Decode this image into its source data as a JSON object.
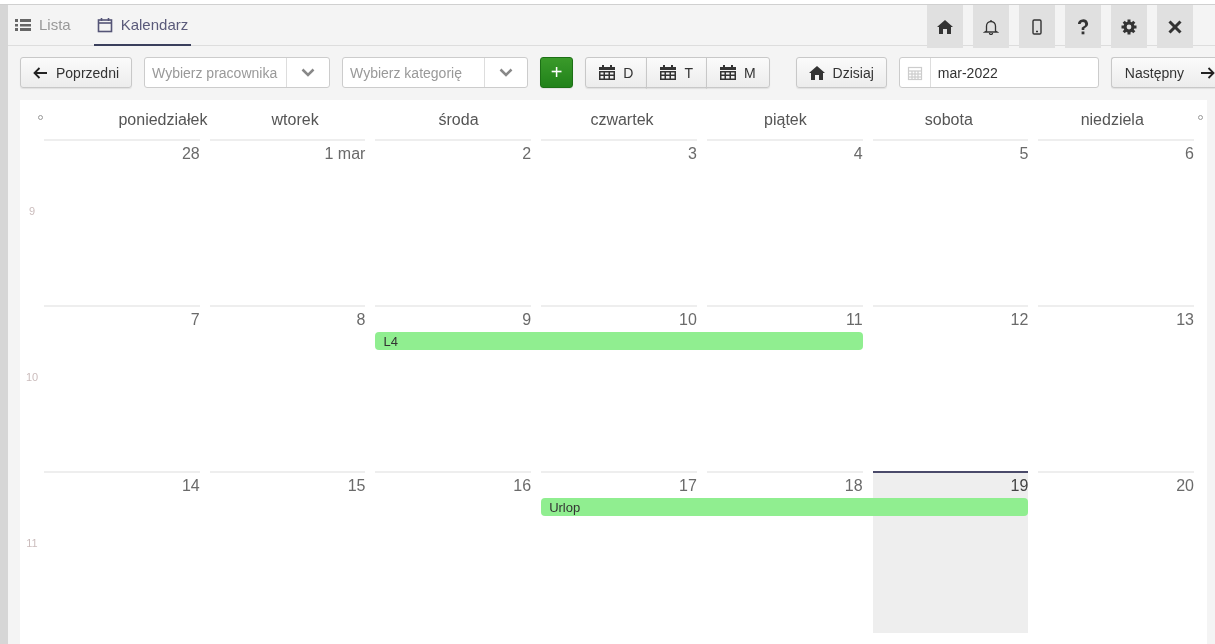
{
  "tabs": [
    {
      "label": "Lista",
      "selected": false
    },
    {
      "label": "Kalendarz",
      "selected": true
    }
  ],
  "toolbar": {
    "previous": {
      "label": "Poprzedni"
    },
    "selects": [
      {
        "placeholder": "Wybierz pracownika"
      },
      {
        "placeholder": "Wybierz kategorię"
      }
    ],
    "add_button": {
      "label": "+"
    },
    "views": [
      {
        "label": "D",
        "selected": false
      },
      {
        "label": "T",
        "selected": false
      },
      {
        "label": "M",
        "selected": false
      }
    ],
    "today_button": {
      "label": "Dzisiaj"
    },
    "date_field": {
      "value": "mar-2022"
    },
    "next": {
      "label": "Następny"
    }
  },
  "calendar": {
    "weekdays": [
      "poniedziałek",
      "wtorek",
      "środa",
      "czwartek",
      "piątek",
      "sobota",
      "niedziela"
    ],
    "weeks": [
      {
        "week_number": "9",
        "days": [
          {
            "label": "28",
            "today": false
          },
          {
            "label": "1 mar",
            "today": false
          },
          {
            "label": "2",
            "today": false
          },
          {
            "label": "3",
            "today": false
          },
          {
            "label": "4",
            "today": false
          },
          {
            "label": "5",
            "today": false
          },
          {
            "label": "6",
            "today": false
          }
        ]
      },
      {
        "week_number": "10",
        "days": [
          {
            "label": "7",
            "today": false
          },
          {
            "label": "8",
            "today": false
          },
          {
            "label": "9",
            "today": false
          },
          {
            "label": "10",
            "today": false
          },
          {
            "label": "11",
            "today": false
          },
          {
            "label": "12",
            "today": false
          },
          {
            "label": "13",
            "today": false
          }
        ],
        "events": [
          {
            "title": "L4",
            "days": [
              false,
              false,
              true,
              true,
              true,
              false,
              false
            ]
          }
        ]
      },
      {
        "week_number": "11",
        "days": [
          {
            "label": "14",
            "today": false
          },
          {
            "label": "15",
            "today": false
          },
          {
            "label": "16",
            "today": false
          },
          {
            "label": "17",
            "today": false
          },
          {
            "label": "18",
            "today": false
          },
          {
            "label": "19",
            "today": true
          },
          {
            "label": "20",
            "today": false
          }
        ],
        "events": [
          {
            "title": "Urlop",
            "days": [
              false,
              false,
              false,
              true,
              true,
              true,
              false
            ]
          }
        ]
      }
    ]
  }
}
